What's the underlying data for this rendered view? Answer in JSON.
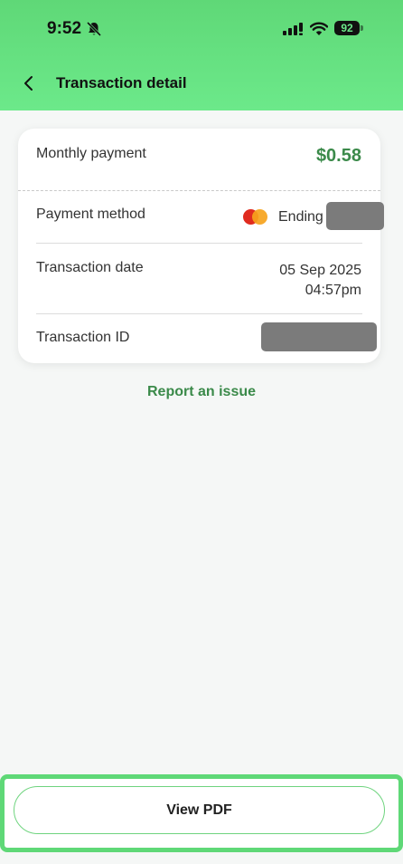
{
  "status_bar": {
    "time": "9:52",
    "battery": "92",
    "icons": [
      "bell-off-icon",
      "signal-icon",
      "wifi-icon",
      "battery-icon"
    ]
  },
  "header": {
    "title": "Transaction detail",
    "back_icon": "chevron-left-icon"
  },
  "details": {
    "monthly_payment_label": "Monthly payment",
    "monthly_payment_value": "$0.58",
    "payment_method_label": "Payment method",
    "payment_method_brand_icon": "mastercard-icon",
    "payment_method_value": "Ending",
    "transaction_date_label": "Transaction date",
    "transaction_date": "05 Sep 2025",
    "transaction_time": "04:57pm",
    "transaction_id_label": "Transaction ID"
  },
  "report_link": "Report an issue",
  "footer": {
    "view_pdf_label": "View PDF"
  },
  "colors": {
    "header_green": "#6ce98a",
    "accent_green": "#3b8a4a",
    "frame_green": "#5fd877"
  }
}
